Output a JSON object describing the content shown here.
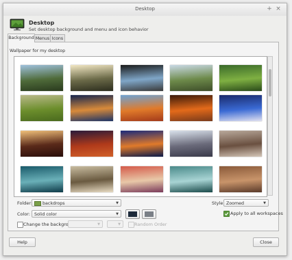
{
  "window": {
    "title": "Desktop"
  },
  "header": {
    "title": "Desktop",
    "subtitle": "Set desktop background and menu and icon behavior",
    "icon": "desktop-monitor-icon"
  },
  "tabs": [
    {
      "label": "Background"
    },
    {
      "label": "Menus"
    },
    {
      "label": "Icons"
    }
  ],
  "wallpaper_label": "Wallpaper for my desktop",
  "thumbnails": [
    {
      "name": "mountain-valley",
      "colors": [
        "#9fc1dd",
        "#4f6b3a",
        "#2a3a1e"
      ]
    },
    {
      "name": "sunburst-trees",
      "colors": [
        "#f2e7c4",
        "#6b6a48",
        "#2c2d1e"
      ]
    },
    {
      "name": "window-view",
      "colors": [
        "#1a1a1a",
        "#7fa6c8",
        "#3a3a3a"
      ]
    },
    {
      "name": "winding-river",
      "colors": [
        "#c9d9e6",
        "#6d8a4a",
        "#3e4e2a"
      ]
    },
    {
      "name": "lone-tree-field",
      "colors": [
        "#3a6a2a",
        "#7fb042",
        "#2a4a1a"
      ]
    },
    {
      "name": "green-meadow",
      "colors": [
        "#b9b98a",
        "#6c8e2c",
        "#4a6a1e"
      ]
    },
    {
      "name": "blue-sunset-sea",
      "colors": [
        "#14254f",
        "#d88a3a",
        "#1c3366"
      ]
    },
    {
      "name": "red-autumn-hill",
      "colors": [
        "#6ea3d4",
        "#e07a2a",
        "#a33a1a"
      ]
    },
    {
      "name": "orange-sunset-clouds",
      "colors": [
        "#3a1a0a",
        "#e36a1a",
        "#7a3a1a"
      ]
    },
    {
      "name": "deep-blue-beach",
      "colors": [
        "#1a2a6a",
        "#3a6ad4",
        "#e0e0f0"
      ]
    },
    {
      "name": "pier-sunset",
      "colors": [
        "#f0c07a",
        "#5a2a1a",
        "#2a0e0a"
      ]
    },
    {
      "name": "red-forest",
      "colors": [
        "#2a1a3a",
        "#b03a1a",
        "#d0602a"
      ]
    },
    {
      "name": "purple-lake-sunset",
      "colors": [
        "#1a2a7a",
        "#e07a2a",
        "#0a1a4a"
      ]
    },
    {
      "name": "building-spire",
      "colors": [
        "#d8e0ea",
        "#6a6a7a",
        "#3a3a4a"
      ]
    },
    {
      "name": "old-building",
      "colors": [
        "#b8a89a",
        "#6a5040",
        "#d4c6b8"
      ]
    },
    {
      "name": "teal-water-texture",
      "colors": [
        "#1a5a6a",
        "#6ab0b8",
        "#0e3a48"
      ]
    },
    {
      "name": "reed-grass",
      "colors": [
        "#c8bca0",
        "#6a5a40",
        "#e8dcc4"
      ]
    },
    {
      "name": "glass-mosaic",
      "colors": [
        "#d45a4a",
        "#e8c8a8",
        "#7a3a5a"
      ]
    },
    {
      "name": "cyan-abstract",
      "colors": [
        "#4a8a8a",
        "#a8d4d4",
        "#1a4a4a"
      ]
    },
    {
      "name": "sandstone-texture",
      "colors": [
        "#8a5a3a",
        "#c8946a",
        "#5a3a2a"
      ]
    }
  ],
  "folder": {
    "label": "Folder:",
    "value": "backdrops"
  },
  "style": {
    "label": "Style:",
    "value": "Zoomed"
  },
  "color": {
    "label": "Color:",
    "value": "Solid color",
    "primary": "#1d2a3a",
    "secondary": "#7a7f86"
  },
  "apply_all": {
    "label": "Apply to all workspaces",
    "checked": true
  },
  "change_bg": {
    "label": "Change the background",
    "checked": false,
    "interval_value": "",
    "number_value": "",
    "random_label": "Random Order"
  },
  "buttons": {
    "help": "Help",
    "close": "Close"
  }
}
